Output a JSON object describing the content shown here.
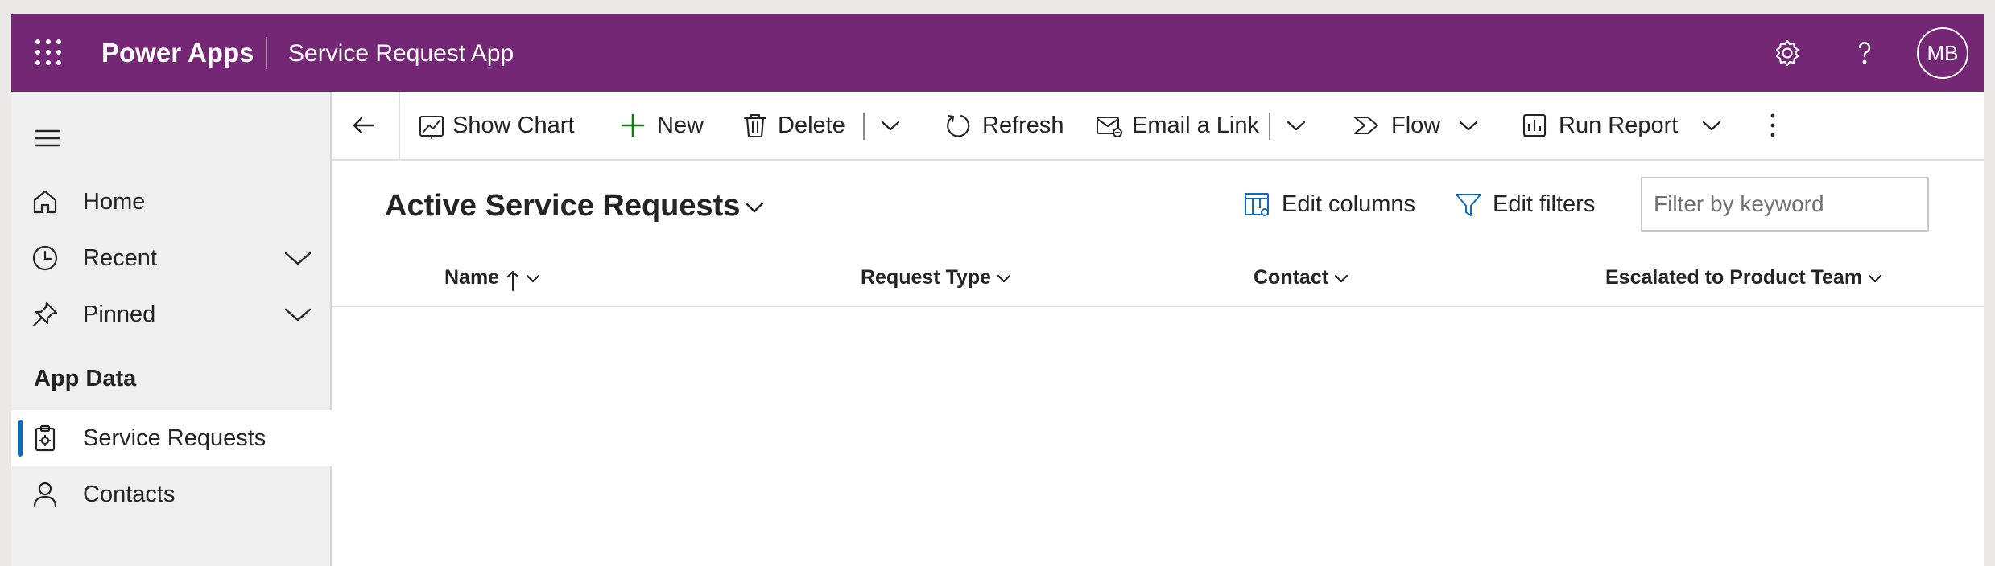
{
  "colors": {
    "header_bg": "#742774",
    "accent": "#0f6cbd",
    "new_icon": "#107c10",
    "sidebar_bg": "#efefef"
  },
  "header": {
    "app_name": "Power Apps",
    "app_title": "Service Request App",
    "user_initials": "MB",
    "icons": [
      "waffle-icon",
      "settings-icon",
      "help-icon"
    ]
  },
  "sidebar": {
    "items": [
      {
        "label": "Home",
        "icon": "home-icon"
      },
      {
        "label": "Recent",
        "icon": "clock-icon",
        "expandable": true
      },
      {
        "label": "Pinned",
        "icon": "pin-icon",
        "expandable": true
      }
    ],
    "section_title": "App Data",
    "entities": [
      {
        "label": "Service Requests",
        "icon": "clipboard-gear-icon",
        "selected": true
      },
      {
        "label": "Contacts",
        "icon": "person-icon",
        "selected": false
      }
    ]
  },
  "commands": {
    "show_chart": "Show Chart",
    "new": "New",
    "delete": "Delete",
    "refresh": "Refresh",
    "email_link": "Email a Link",
    "flow": "Flow",
    "run_report": "Run Report"
  },
  "view": {
    "title": "Active Service Requests",
    "edit_columns": "Edit columns",
    "edit_filters": "Edit filters",
    "filter_placeholder": "Filter by keyword"
  },
  "grid": {
    "columns": [
      {
        "label": "Name",
        "sorted": "ascending"
      },
      {
        "label": "Request Type"
      },
      {
        "label": "Contact"
      },
      {
        "label": "Escalated to Product Team"
      }
    ],
    "rows": []
  }
}
